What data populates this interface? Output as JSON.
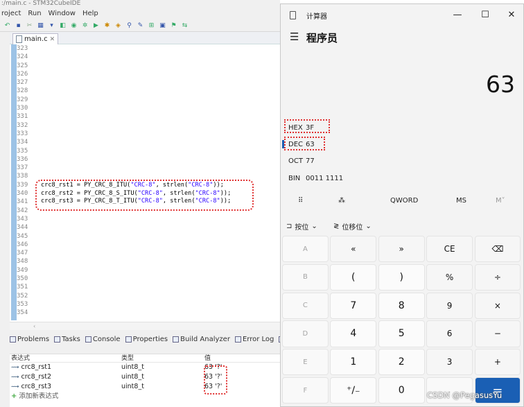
{
  "ide": {
    "title": ":/main.c - STM32CubeIDE",
    "menus": [
      "roject",
      "Run",
      "Window",
      "Help"
    ],
    "tab_label": "main.c",
    "line_numbers": [
      "323",
      "324",
      "325",
      "326",
      "327",
      "328",
      "329",
      "330",
      "331",
      "332",
      "333",
      "334",
      "335",
      "336",
      "337",
      "338",
      "339",
      "340",
      "341",
      "342",
      "343",
      "344",
      "345",
      "346",
      "347",
      "348",
      "349",
      "350",
      "351",
      "352",
      "353",
      "354"
    ],
    "code": [
      {
        "pre": "crc8_rst1 = PY_CRC_8_ITU(",
        "s1": "\"CRC-8\"",
        "mid": ", strlen(",
        "s2": "\"CRC-8\"",
        "post": "));"
      },
      {
        "pre": "crc8_rst2 = PY_CRC_8_S_ITU(",
        "s1": "\"CRC-8\"",
        "mid": ", strlen(",
        "s2": "\"CRC-8\"",
        "post": "));"
      },
      {
        "pre": "crc8_rst3 = PY_CRC_8_T_ITU(",
        "s1": "\"CRC-8\"",
        "mid": ", strlen(",
        "s2": "\"CRC-8\"",
        "post": "));"
      }
    ],
    "panel_tabs": [
      "Problems",
      "Tasks",
      "Console",
      "Properties",
      "Build Analyzer",
      "Error Log",
      "O"
    ],
    "expressions": {
      "headers": [
        "表达式",
        "类型",
        "值"
      ],
      "rows": [
        {
          "name": "crc8_rst1",
          "type": "uint8_t",
          "value": "63 '?'"
        },
        {
          "name": "crc8_rst2",
          "type": "uint8_t",
          "value": "63 '?'"
        },
        {
          "name": "crc8_rst3",
          "type": "uint8_t",
          "value": "63 '?'"
        }
      ],
      "add_label": "添加新表达式"
    }
  },
  "calc": {
    "window_title": "计算器",
    "mode": "程序员",
    "display": "63",
    "radix": [
      {
        "key": "HEX",
        "value": "3F"
      },
      {
        "key": "DEC",
        "value": "63"
      },
      {
        "key": "OCT",
        "value": "77"
      },
      {
        "key": "BIN",
        "value": "0011 1111"
      }
    ],
    "word_size": "QWORD",
    "ms": "MS",
    "mv": "M˅",
    "bitwise": "按位",
    "bitshift": "位移位",
    "keys": [
      [
        "A",
        "«",
        "»",
        "CE",
        "⌫"
      ],
      [
        "B",
        "(",
        ")",
        "%",
        "÷"
      ],
      [
        "C",
        "7",
        "8",
        "9",
        "×"
      ],
      [
        "D",
        "4",
        "5",
        "6",
        "−"
      ],
      [
        "E",
        "1",
        "2",
        "3",
        "+"
      ],
      [
        "F",
        "⁺∕₋",
        "0",
        ".",
        "="
      ]
    ]
  },
  "watermark": "CSDN @PegasusYu"
}
